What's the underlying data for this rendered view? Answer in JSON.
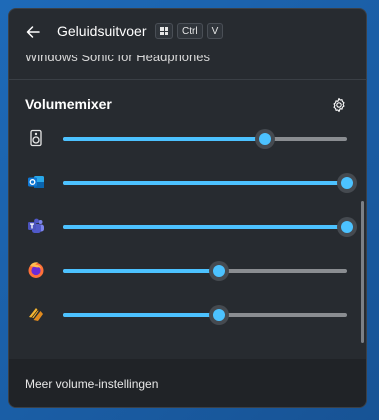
{
  "header": {
    "title": "Geluidsuitvoer",
    "shortcut_keys": [
      "Ctrl",
      "V"
    ]
  },
  "partial_item": "Windows Sonic for Headphones",
  "mixer": {
    "title": "Volumemixer",
    "apps": [
      {
        "icon": "speaker-icon",
        "volume": 0.71
      },
      {
        "icon": "outlook-icon",
        "volume": 1.0
      },
      {
        "icon": "teams-icon",
        "volume": 1.0
      },
      {
        "icon": "firefox-icon",
        "volume": 0.55
      },
      {
        "icon": "winamp-icon",
        "volume": 0.55
      }
    ]
  },
  "footer": {
    "link": "Meer volume-instellingen"
  },
  "colors": {
    "accent": "#4cc2ff",
    "panel": "#272b30",
    "track": "#8a8d91"
  }
}
